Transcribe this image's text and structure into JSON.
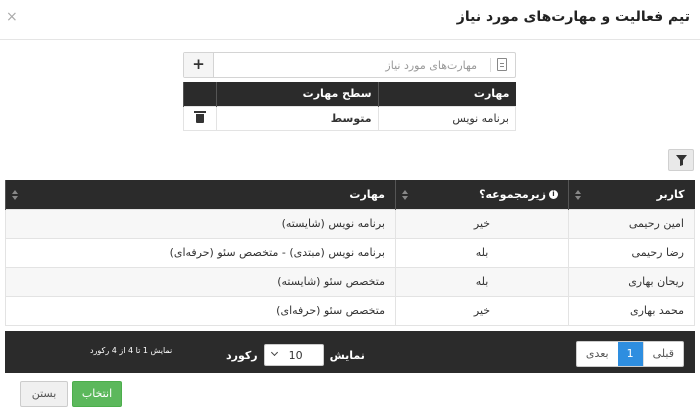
{
  "modal": {
    "title": "تیم فعالیت و مهارت‌های مورد نیاز",
    "close": "×"
  },
  "skill_input": {
    "add_label": "+",
    "placeholder": "مهارت‌های مورد نیاز"
  },
  "skills_table": {
    "headers": [
      "مهارت",
      "سطح مهارت"
    ],
    "rows": [
      {
        "skill": "برنامه نویس",
        "level": "متوسط"
      }
    ]
  },
  "main_table": {
    "headers": {
      "user": "کاربر",
      "subset": "زیرمجموعه؟",
      "skills": "مهارت"
    },
    "rows": [
      {
        "user": "امین رحیمی",
        "subset": "خیر",
        "skills": "برنامه نویس (شایسته)"
      },
      {
        "user": "رضا رحیمی",
        "subset": "بله",
        "skills": "برنامه نویس (مبتدی) - متخصص سئو (حرفه‌ای)"
      },
      {
        "user": "ریحان بهاری",
        "subset": "بله",
        "skills": "متخصص سئو (شایسته)"
      },
      {
        "user": "محمد بهاری",
        "subset": "خیر",
        "skills": "متخصص سئو (حرفه‌ای)"
      }
    ]
  },
  "footer": {
    "pager": {
      "prev": "قبلی",
      "current": "1",
      "next": "بعدی"
    },
    "length_label_show": "نمایش",
    "length_value": "10",
    "length_label_record": "رکورد",
    "info": "نمایش 1 تا 4 از 4 رکورد"
  },
  "buttons": {
    "select": "انتخاب",
    "close": "بستن"
  },
  "colors": {
    "header_dark": "#2b2b2b",
    "primary": "#2e8ee0",
    "success": "#5cb85c"
  }
}
